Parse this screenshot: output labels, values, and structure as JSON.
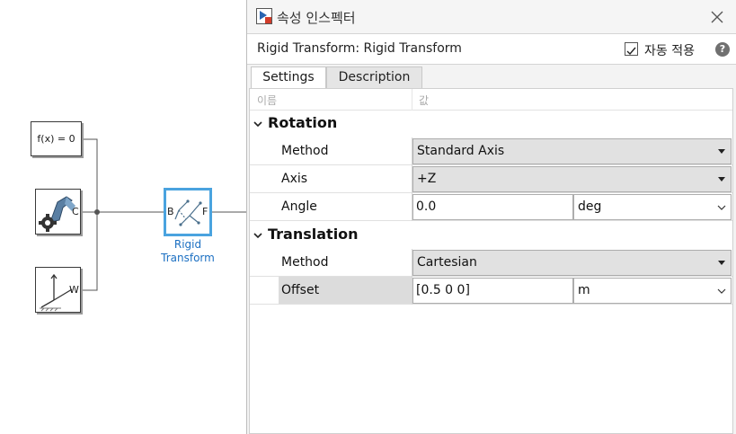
{
  "canvas": {
    "fx_block": {
      "label": "f(x) = 0"
    },
    "solver_block": {
      "port": "C"
    },
    "world_block": {
      "port": "W"
    },
    "rigid_block": {
      "port_b": "B",
      "port_f": "F",
      "caption_line1": "Rigid",
      "caption_line2": "Transform"
    }
  },
  "inspector": {
    "title": "속성 인스펙터",
    "block_path": "Rigid Transform: Rigid Transform",
    "auto_apply": {
      "label": "자동 적용",
      "checked": true
    },
    "help_label": "?",
    "tabs": [
      {
        "label": "Settings",
        "active": true
      },
      {
        "label": "Description",
        "active": false
      }
    ],
    "columns": {
      "name": "이름",
      "value": "값"
    },
    "rotation": {
      "title": "Rotation",
      "method": {
        "label": "Method",
        "value": "Standard Axis"
      },
      "axis": {
        "label": "Axis",
        "value": "+Z"
      },
      "angle": {
        "label": "Angle",
        "value": "0.0",
        "unit": "deg"
      }
    },
    "translation": {
      "title": "Translation",
      "method": {
        "label": "Method",
        "value": "Cartesian"
      },
      "offset": {
        "label": "Offset",
        "value": "[0.5 0 0]",
        "unit": "m"
      }
    }
  },
  "colors": {
    "selection_blue": "#4aa3df",
    "caption_blue": "#1b6fc2",
    "grid_highlight": "#dcdcdc"
  }
}
